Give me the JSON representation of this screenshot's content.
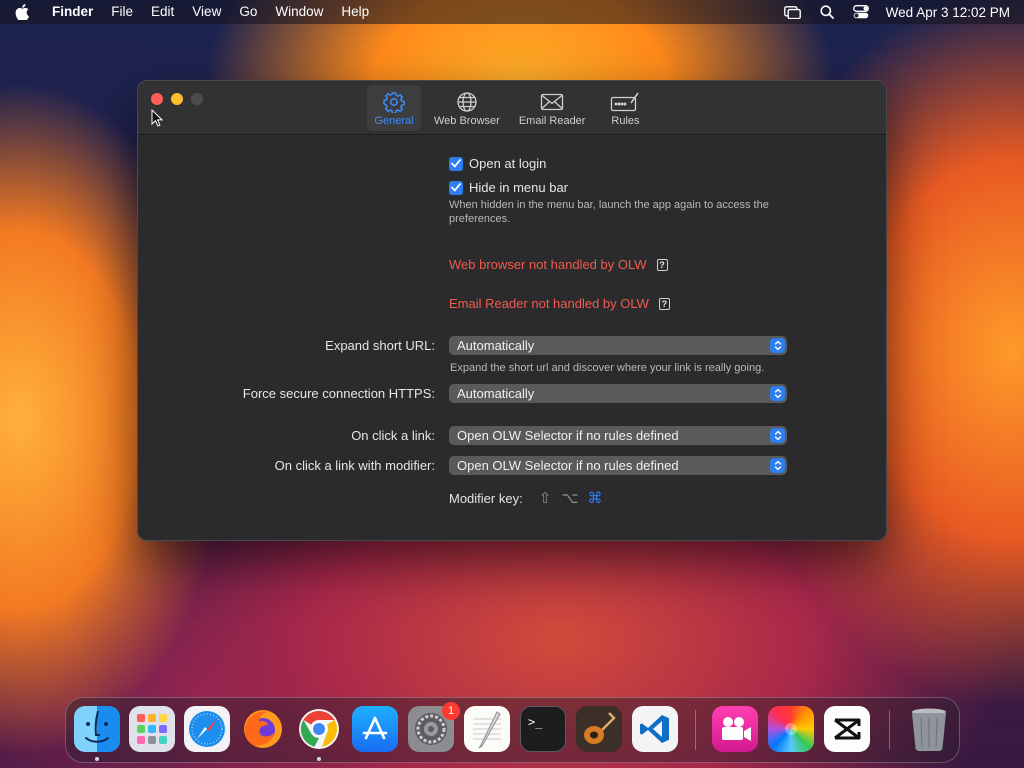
{
  "menubar": {
    "app_name": "Finder",
    "items": [
      "File",
      "Edit",
      "View",
      "Go",
      "Window",
      "Help"
    ],
    "clock": "Wed Apr 3  12:02 PM",
    "status_icons": [
      "screen-mirroring-icon",
      "search-icon",
      "control-center-icon"
    ]
  },
  "window": {
    "tabs": [
      {
        "label": "General",
        "icon": "gear-icon",
        "active": true
      },
      {
        "label": "Web Browser",
        "icon": "globe-icon",
        "active": false
      },
      {
        "label": "Email Reader",
        "icon": "envelope-icon",
        "active": false
      },
      {
        "label": "Rules",
        "icon": "rules-icon",
        "active": false
      }
    ],
    "general": {
      "open_at_login": {
        "label": "Open at login",
        "checked": true
      },
      "hide_in_menu_bar": {
        "label": "Hide in menu bar",
        "checked": true
      },
      "hide_hint": "When hidden in the menu bar, launch the app again to access the preferences.",
      "web_browser_warning": "Web browser not handled by OLW",
      "email_reader_warning": "Email Reader not handled by OLW",
      "help_glyph": "?",
      "expand_short_url": {
        "label": "Expand short URL:",
        "value": "Automatically",
        "hint": "Expand the short url and discover where your link is really going."
      },
      "force_https": {
        "label": "Force secure connection HTTPS:",
        "value": "Automatically"
      },
      "on_click_link": {
        "label": "On click a link:",
        "value": "Open OLW Selector if no rules defined"
      },
      "on_click_link_modifier": {
        "label": "On click a link with modifier:",
        "value": "Open OLW Selector if no rules defined"
      },
      "modifier_key": {
        "label": "Modifier key:",
        "keys": [
          {
            "glyph": "⇧",
            "name": "shift",
            "selected": false
          },
          {
            "glyph": "⌥",
            "name": "option",
            "selected": false
          },
          {
            "glyph": "⌘",
            "name": "command",
            "selected": true
          }
        ]
      }
    }
  },
  "dock": {
    "apps": [
      "Finder",
      "Launchpad",
      "Safari",
      "Firefox",
      "Chrome",
      "App Store",
      "System Settings",
      "TextEdit",
      "Terminal",
      "GarageBand",
      "Visual Studio Code",
      "Screen Recorder",
      "Photos",
      "CapCut",
      "Trash"
    ],
    "system_settings_badge": "1",
    "terminal_prompt": ">_"
  },
  "colors": {
    "accent": "#2f7ef0",
    "warning": "#ef5b4e",
    "window_bg": "#2b2b2d"
  }
}
